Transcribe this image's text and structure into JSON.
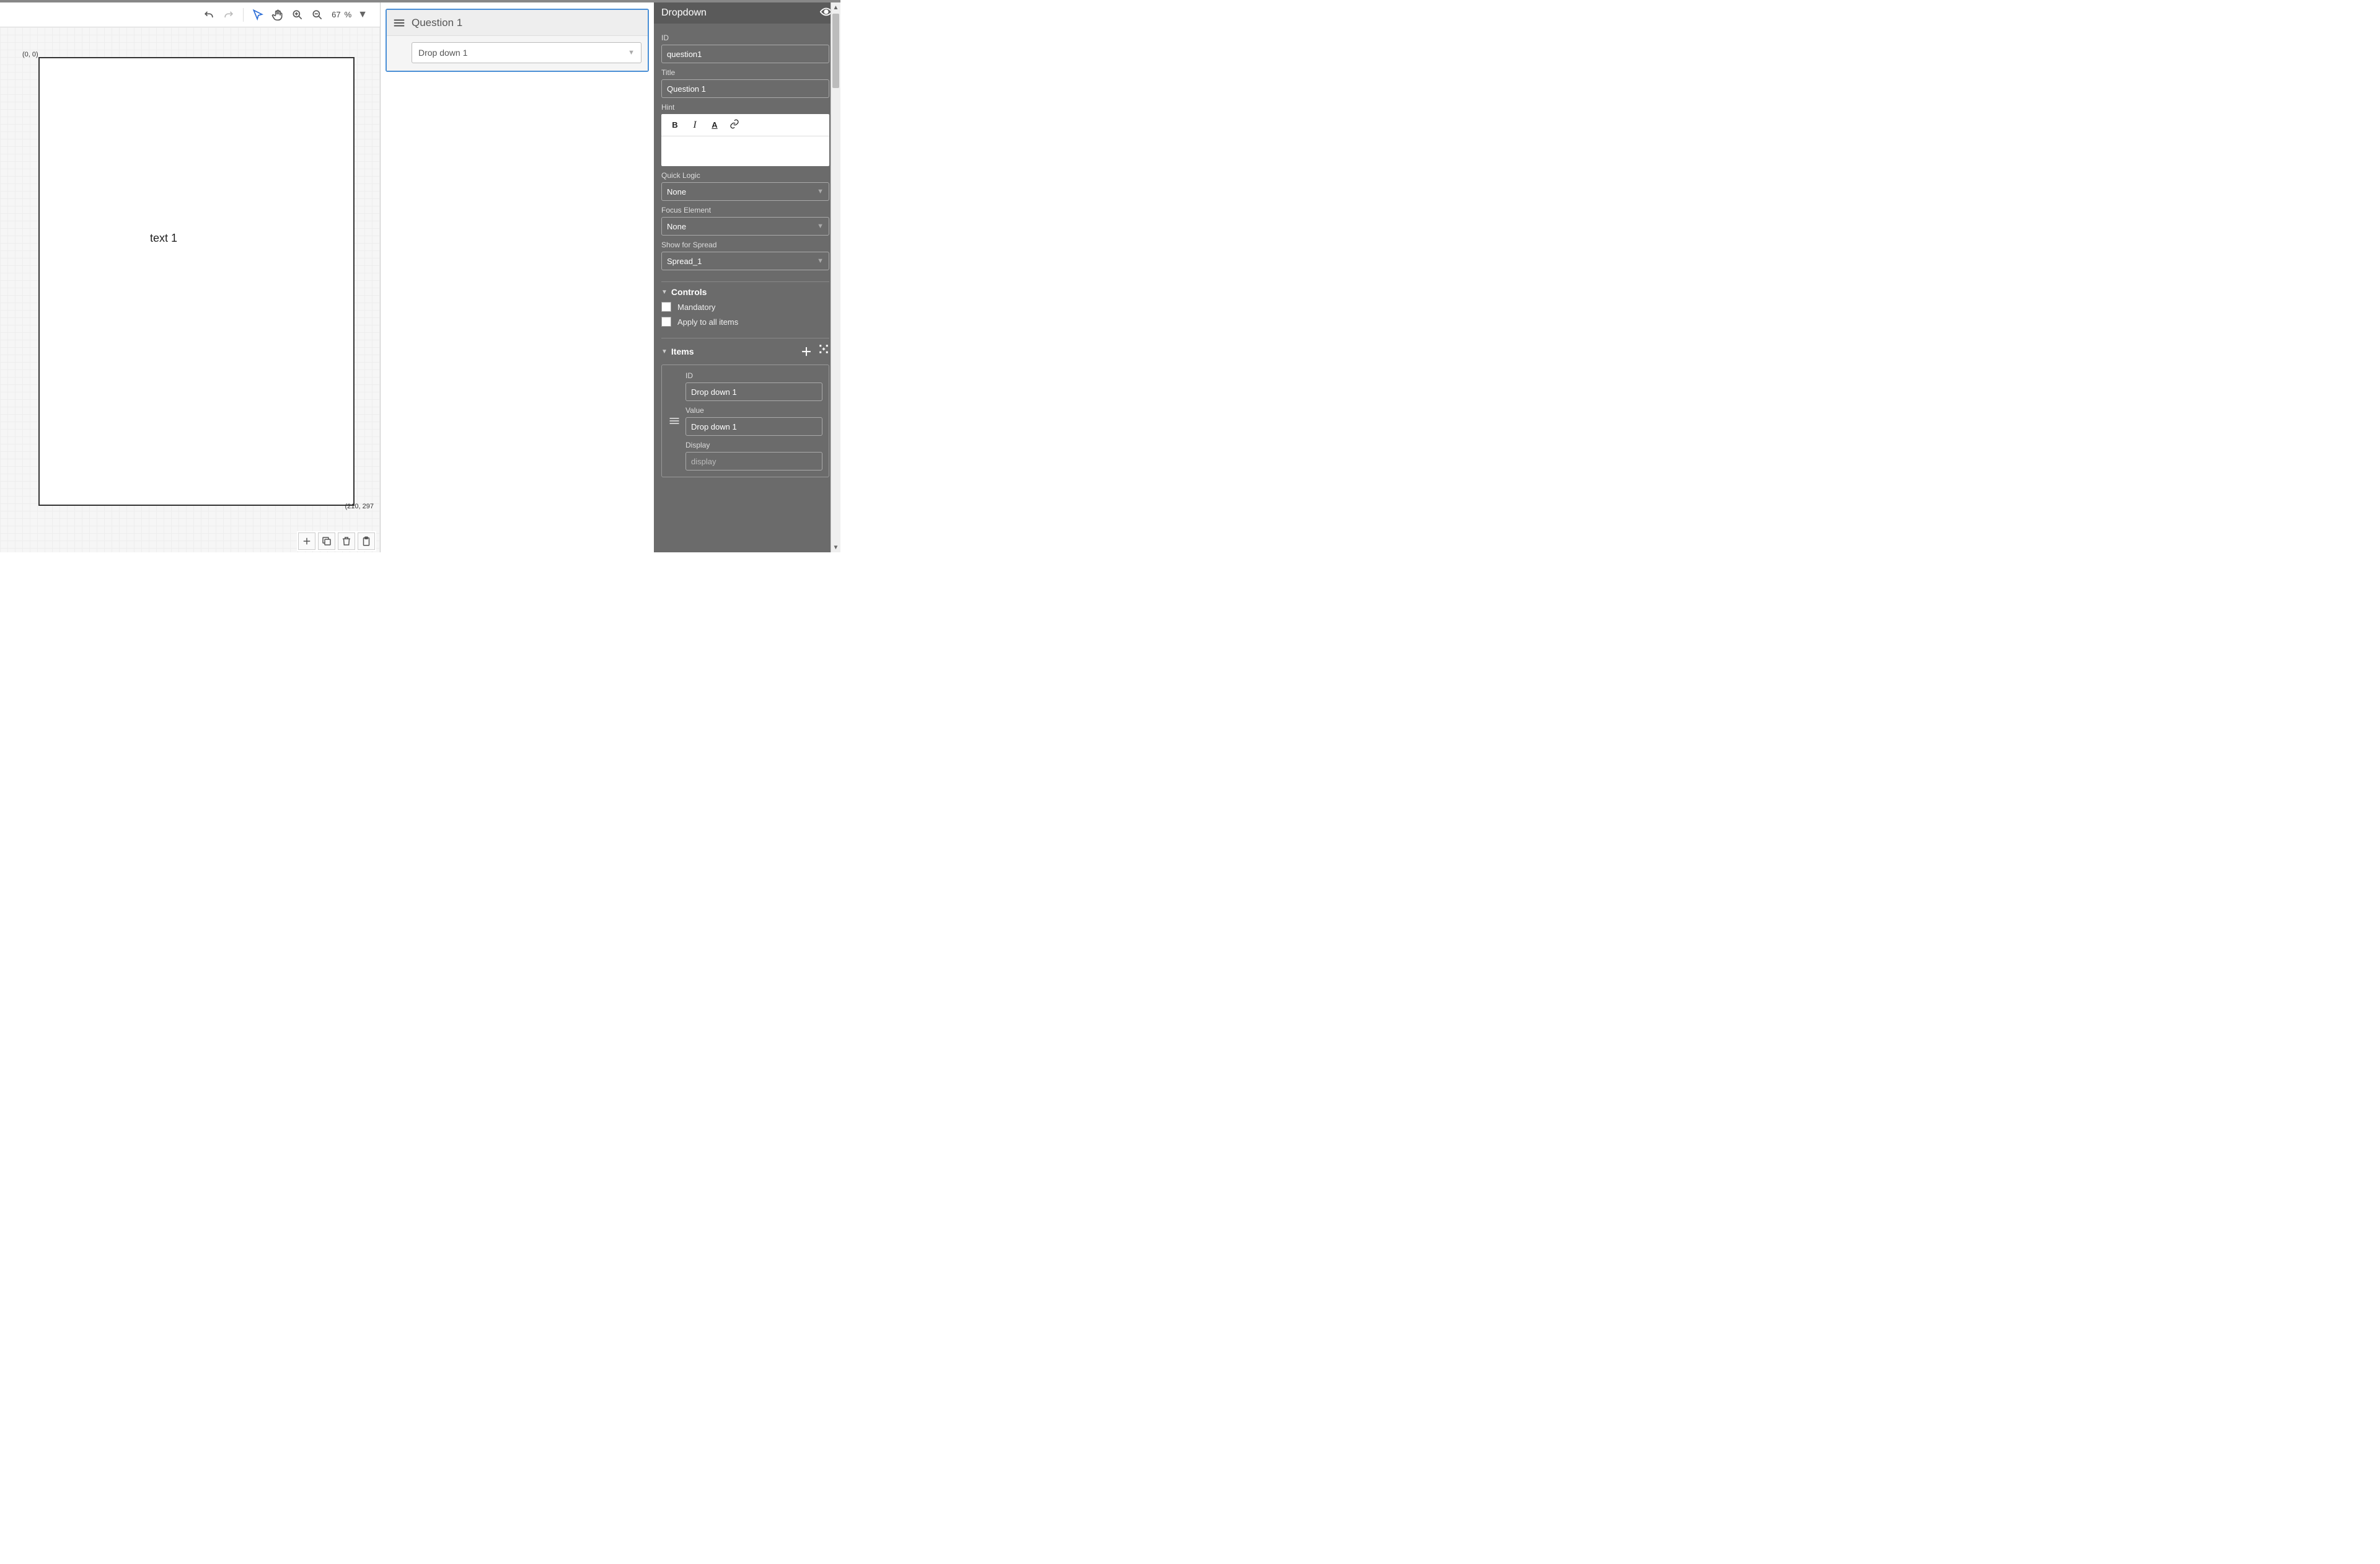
{
  "canvas": {
    "origin_label": "(0, 0)",
    "bottom_right_label": "(210, 297",
    "page_text": "text 1",
    "zoom_value": "67",
    "zoom_unit": "%"
  },
  "question": {
    "title": "Question 1",
    "dropdown_value": "Drop down 1"
  },
  "props": {
    "header": "Dropdown",
    "id_label": "ID",
    "id_value": "question1",
    "title_label": "Title",
    "title_value": "Question 1",
    "hint_label": "Hint",
    "quick_logic_label": "Quick Logic",
    "quick_logic_value": "None",
    "focus_label": "Focus Element",
    "focus_value": "None",
    "spread_label": "Show for Spread",
    "spread_value": "Spread_1",
    "controls_header": "Controls",
    "mandatory_label": "Mandatory",
    "apply_all_label": "Apply to all items",
    "items_header": "Items",
    "item": {
      "id_label": "ID",
      "id_value": "Drop down 1",
      "value_label": "Value",
      "value_value": "Drop down 1",
      "display_label": "Display",
      "display_placeholder": "display"
    }
  }
}
